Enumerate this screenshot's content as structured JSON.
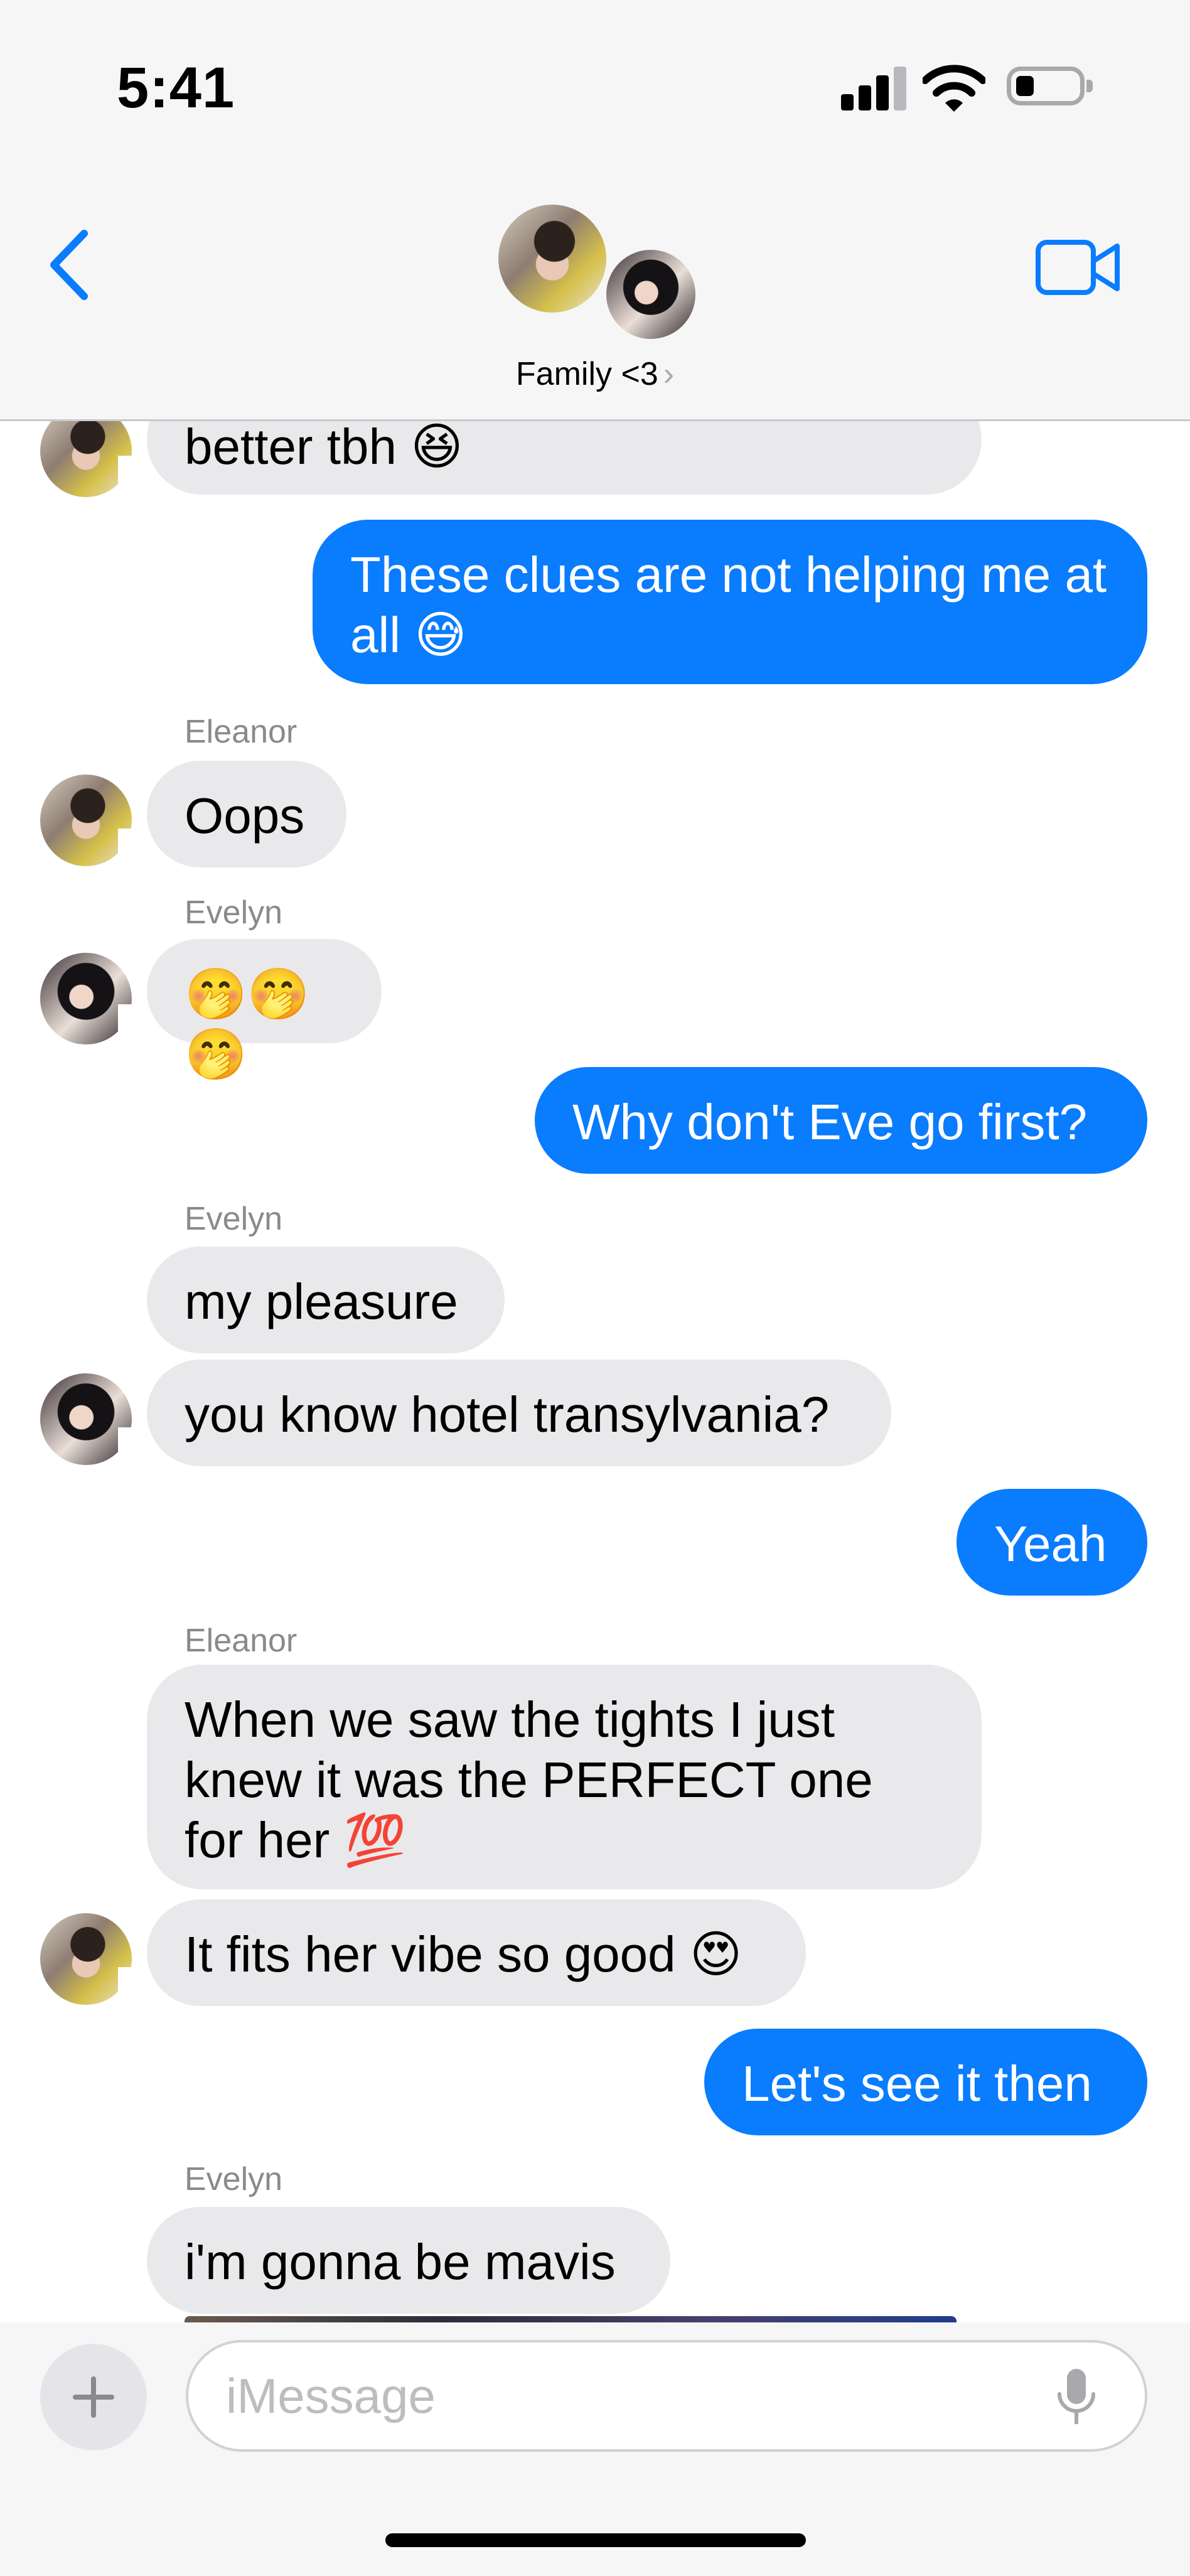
{
  "status_bar": {
    "time": "5:41"
  },
  "header": {
    "group_name": "Family <3",
    "chevron": "›",
    "icons": {
      "back": "chevron-left-icon",
      "video": "video-camera-icon"
    },
    "accent_color": "#0a7cfe"
  },
  "messages": [
    {
      "sender": "Eleanor",
      "direction": "incoming",
      "text": "better tbh",
      "emoji": "😆"
    },
    {
      "sender": "me",
      "direction": "outgoing",
      "text": "These clues are not helping me at all",
      "emoji": "😅"
    },
    {
      "sender": "Eleanor",
      "direction": "incoming",
      "name_label": "Eleanor",
      "text": "Oops"
    },
    {
      "sender": "Evelyn",
      "direction": "incoming",
      "name_label": "Evelyn",
      "text": "",
      "emoji": "🤭🤭🤭"
    },
    {
      "sender": "me",
      "direction": "outgoing",
      "text": "Why don't Eve go first?"
    },
    {
      "sender": "Evelyn",
      "direction": "incoming",
      "name_label": "Evelyn",
      "text": "my pleasure"
    },
    {
      "sender": "Evelyn",
      "direction": "incoming",
      "text": "you know hotel transylvania?"
    },
    {
      "sender": "me",
      "direction": "outgoing",
      "text": "Yeah"
    },
    {
      "sender": "Eleanor",
      "direction": "incoming",
      "name_label": "Eleanor",
      "text": "When we saw the tights I just knew it was the PERFECT one for her",
      "emoji": "💯"
    },
    {
      "sender": "Eleanor",
      "direction": "incoming",
      "text": "It fits her vibe so good",
      "emoji": "😍"
    },
    {
      "sender": "me",
      "direction": "outgoing",
      "text": "Let's see it then"
    },
    {
      "sender": "Evelyn",
      "direction": "incoming",
      "name_label": "Evelyn",
      "text": "i'm gonna be mavis"
    }
  ],
  "composer": {
    "placeholder": "iMessage",
    "icons": {
      "add": "plus-icon",
      "dictation": "microphone-icon"
    }
  },
  "colors": {
    "outgoing_bubble": "#0a7cfe",
    "incoming_bubble": "#e9e9eb",
    "name_label": "#8a8a8e"
  }
}
